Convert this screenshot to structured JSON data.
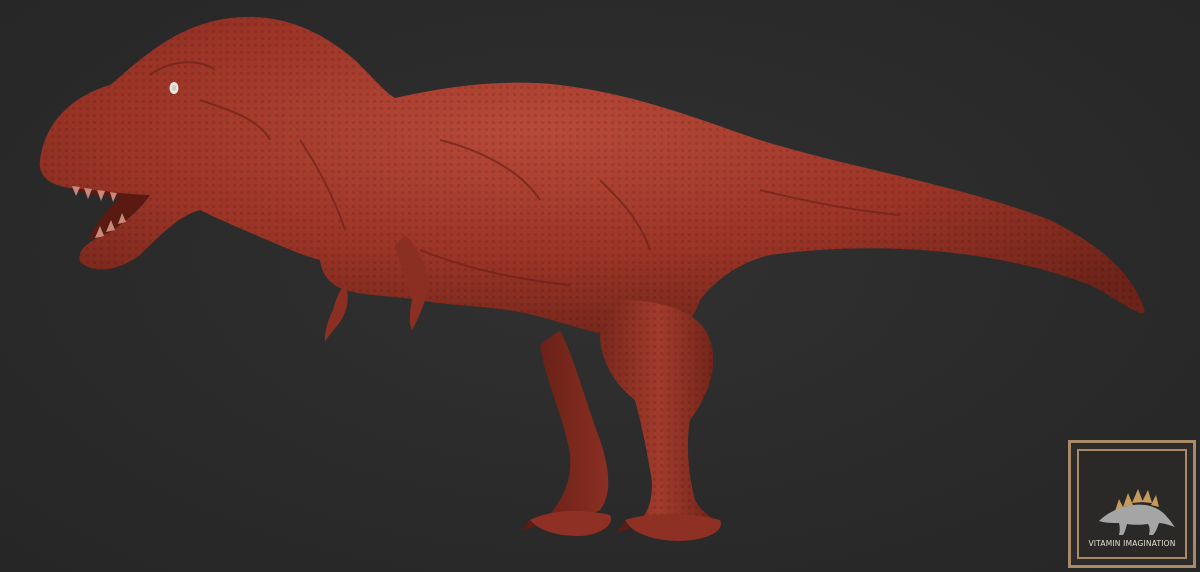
{
  "scene": {
    "subject": "tyrannosaurus-sculpt",
    "background_color": "#2b2b2b",
    "sculpt_color": "#a0392a"
  },
  "watermark": {
    "text": "VITAMIN IMAGINATION",
    "frame_color": "#a88a68",
    "stego_color": "#a5a5a5",
    "plate_color": "#c69a5b"
  }
}
